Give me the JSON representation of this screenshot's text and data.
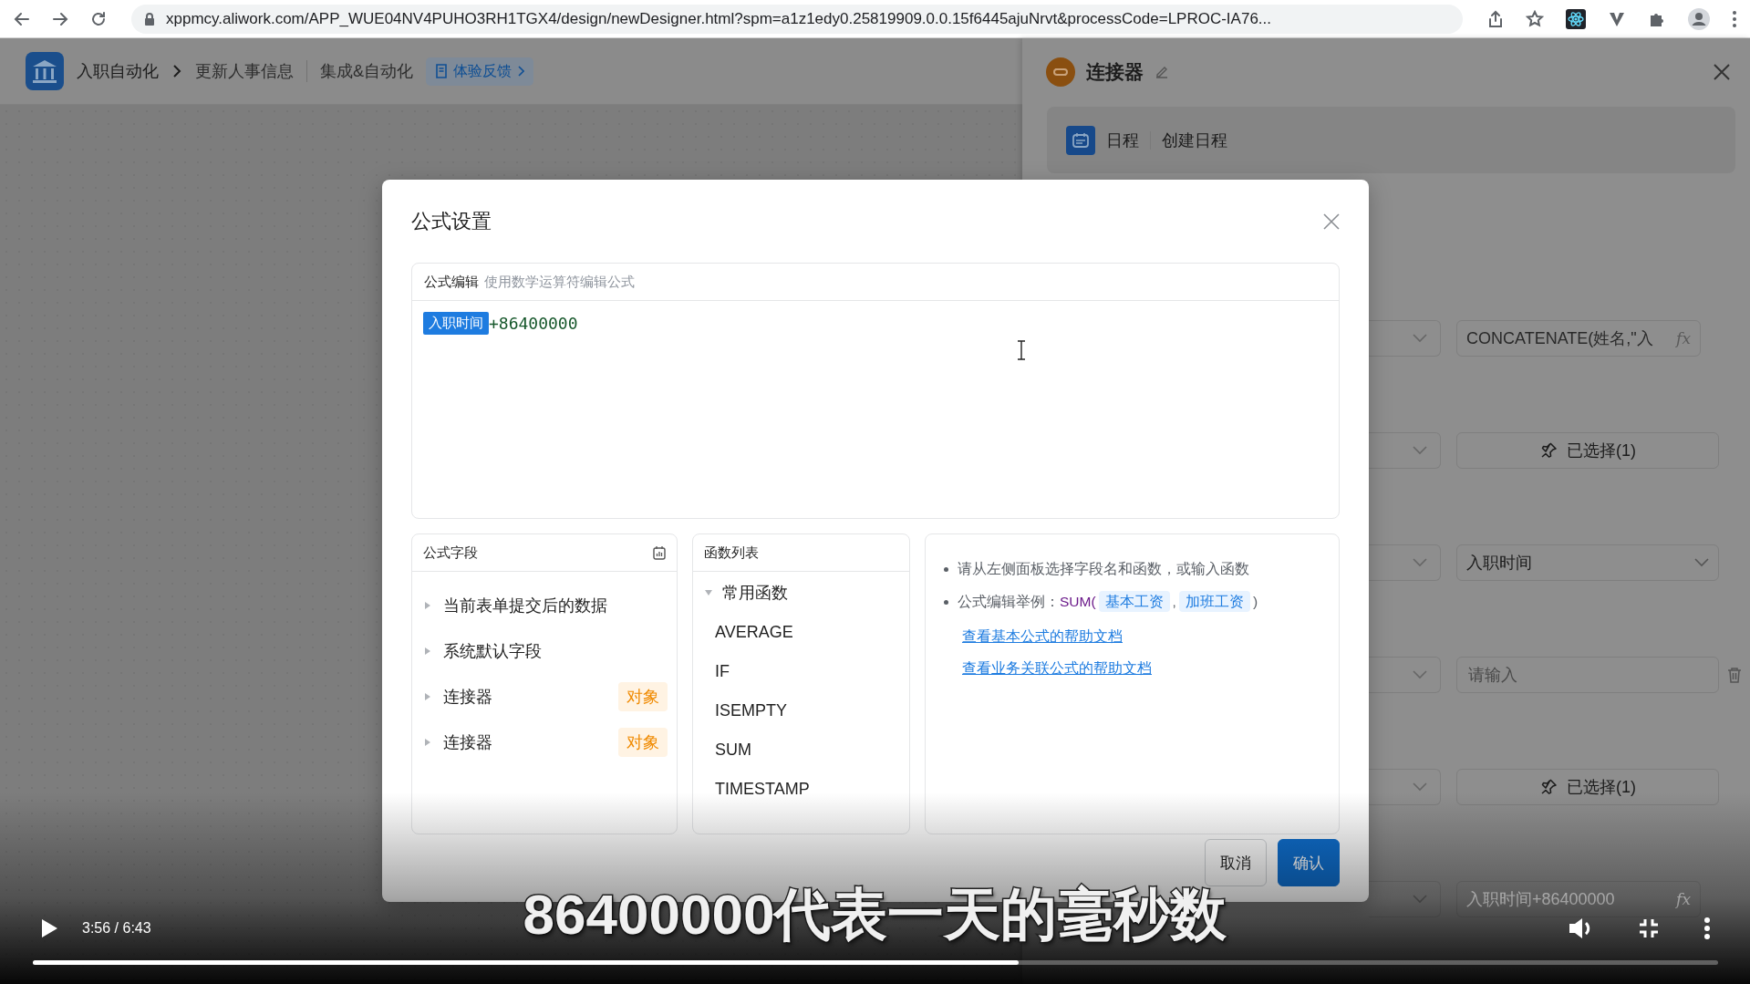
{
  "browser": {
    "url": "xppmcy.aliwork.com/APP_WUE04NV4PUHO3RH1TGX4/design/newDesigner.html?spm=a1z1edy0.25819909.0.0.15f6445ajuNrvt&processCode=LPROC-IA76..."
  },
  "app_header": {
    "breadcrumb": [
      "入职自动化",
      "更新人事信息"
    ],
    "section": "集成&自动化",
    "feedback": "体验反馈"
  },
  "side_panel": {
    "title": "连接器",
    "action": {
      "app": "日程",
      "name": "创建日程"
    },
    "rows": [
      {
        "kind": "formula",
        "value": "CONCATENATE(姓名,\"入",
        "button": "fx"
      },
      {
        "kind": "selected",
        "value": "已选择(1)"
      },
      {
        "kind": "select",
        "value": "入职时间"
      },
      {
        "kind": "input",
        "placeholder": "请输入"
      },
      {
        "kind": "selected",
        "value": "已选择(1)"
      },
      {
        "kind": "formula",
        "value": "入职时间+86400000",
        "button": "fx"
      }
    ]
  },
  "dialog": {
    "title": "公式设置",
    "editor": {
      "label": "公式编辑",
      "hint": "使用数学运算符编辑公式",
      "tokens": [
        {
          "kind": "field",
          "text": "入职时间"
        },
        {
          "kind": "text",
          "text": "+86400000"
        }
      ]
    },
    "fields_panel": {
      "title": "公式字段",
      "items": [
        {
          "label": "当前表单提交后的数据",
          "expanded": false
        },
        {
          "label": "系统默认字段",
          "expanded": false
        },
        {
          "label": "连接器",
          "tag": "对象",
          "expanded": false
        },
        {
          "label": "连接器",
          "tag": "对象",
          "expanded": false
        }
      ]
    },
    "functions_panel": {
      "title": "函数列表",
      "groups": [
        {
          "label": "常用函数",
          "expanded": true,
          "children": [
            "AVERAGE",
            "IF",
            "ISEMPTY",
            "SUM",
            "TIMESTAMP"
          ]
        }
      ]
    },
    "help": {
      "tip": "请从左侧面板选择字段名和函数，或输入函数",
      "example": {
        "label": "公式编辑举例：",
        "func": "SUM(",
        "args": [
          "基本工资",
          "加班工资"
        ],
        "separator": ",",
        "close": ")"
      },
      "links": [
        "查看基本公式的帮助文档",
        "查看业务关联公式的帮助文档"
      ]
    },
    "cancel": "取消",
    "confirm": "确认"
  },
  "player": {
    "playing": false,
    "time": "3:56 / 6:43",
    "subtitle": "86400000代表一天的毫秒数",
    "level": 0.585
  }
}
